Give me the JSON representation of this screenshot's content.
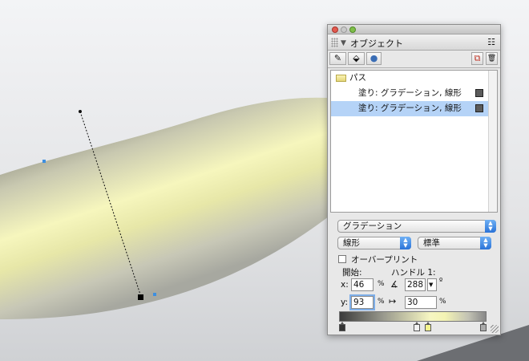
{
  "panel": {
    "title": "オブジェクト",
    "menu_glyph": "☷",
    "tools": {
      "pen": "✎",
      "fill": "⬙",
      "effect": "●",
      "dup": "⧉",
      "trash": "🗑"
    },
    "list": [
      {
        "label": "パス",
        "type": "folder"
      },
      {
        "label": "塗り: グラデーション, 線形",
        "type": "attr",
        "selected": false
      },
      {
        "label": "塗り: グラデーション, 線形",
        "type": "attr",
        "selected": true
      }
    ],
    "fill_type": "グラデーション",
    "gradient_type": "線形",
    "blend_mode": "標準",
    "overprint_label": "オーバープリント",
    "start_label": "開始:",
    "handle_label": "ハンドル 1:",
    "x_label": "x:",
    "y_label": "y:",
    "x_value": "46",
    "y_value": "93",
    "percent": "%",
    "angle_value": "288",
    "degree": "º",
    "length_value": "30",
    "arrow_down": "▼"
  },
  "colors": {
    "selection": "#b5d3f7",
    "accent_blue": "#2a73d8",
    "stop_yellow": "#f4f48e"
  }
}
